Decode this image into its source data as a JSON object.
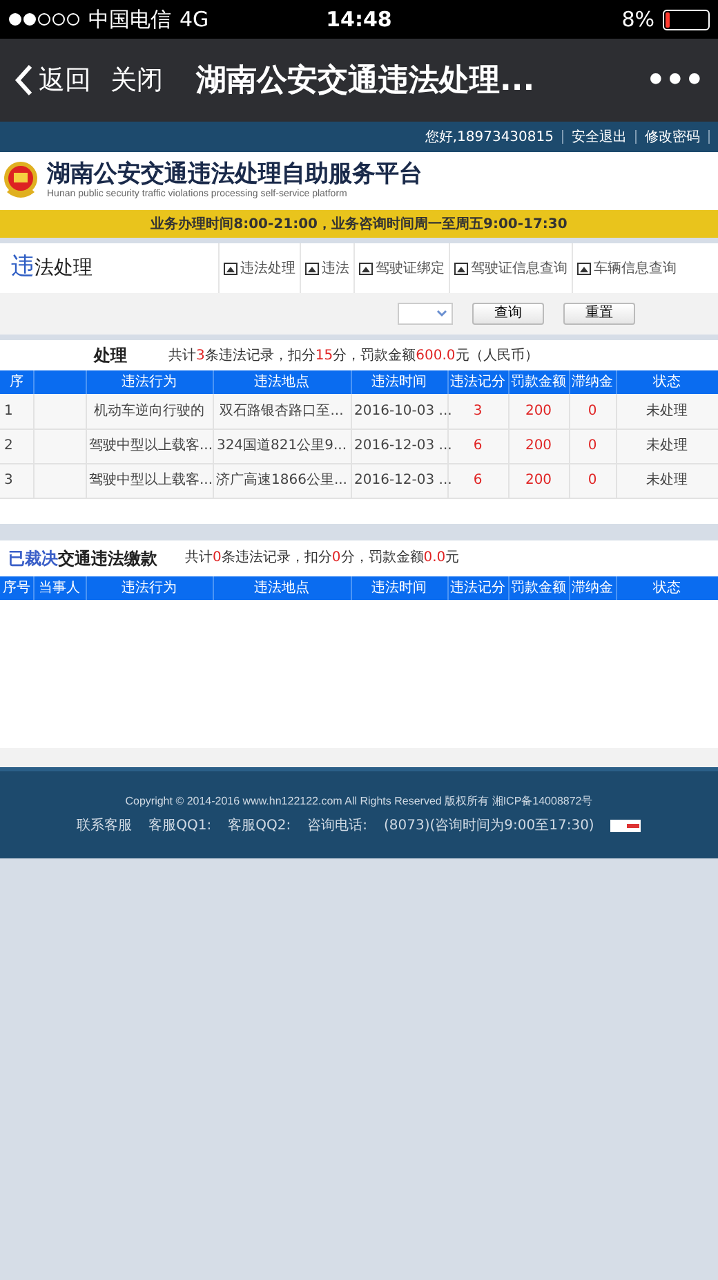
{
  "status_bar": {
    "carrier": "中国电信",
    "network": "4G",
    "time": "14:48",
    "battery": "8%"
  },
  "nav_bar": {
    "back": "返回",
    "close": "关闭",
    "title": "湖南公安交通违法处理...",
    "more": "•••"
  },
  "top_bar": {
    "links": [
      "您好,18973430815",
      "安全退出",
      "修改密码"
    ]
  },
  "site_header": {
    "title": "湖南公安交通违法处理自助服务平台",
    "subtitle": "Hunan public security traffic violations processing self-service platform"
  },
  "notice": "业务办理时间8:00-21:00，业务咨询时间周一至周五9:00-17:30",
  "section_tabs": {
    "title_parts": [
      {
        "text": "违",
        "highlight": true
      },
      {
        "text": "法处理",
        "highlight": false
      }
    ],
    "tabs": [
      {
        "label": "违法处理",
        "selected": false
      },
      {
        "label": "违法",
        "selected": false
      },
      {
        "label": "驾驶证绑定",
        "selected": false
      },
      {
        "label": "驾驶证信息查询",
        "selected": false
      },
      {
        "label": "车辆信息查询",
        "selected": false
      }
    ]
  },
  "search": {
    "buttons": [
      "查询",
      "重置"
    ]
  },
  "pending": {
    "title": "处理",
    "summary": [
      {
        "text": "共计",
        "highlight": false
      },
      {
        "text": "3",
        "highlight": true
      },
      {
        "text": "条违法记录，扣分",
        "highlight": false
      },
      {
        "text": "15",
        "highlight": true
      },
      {
        "text": "分，罚款金额",
        "highlight": false
      },
      {
        "text": "600.0",
        "highlight": true
      },
      {
        "text": "元（人民币）",
        "highlight": false
      }
    ],
    "columns": [
      "序",
      "",
      "违法行为",
      "违法地点",
      "违法时间",
      "违法记分",
      "罚款金额",
      "滞纳金",
      "状态"
    ],
    "rows": [
      [
        "1",
        "",
        "机动车逆向行驶的",
        "双石路银杏路口至...",
        "2016-10-03 ...",
        "3",
        "200",
        "0",
        "未处理"
      ],
      [
        "2",
        "",
        "驾驶中型以上载客...",
        "324国道821公里9...",
        "2016-12-03 ...",
        "6",
        "200",
        "0",
        "未处理"
      ],
      [
        "3",
        "",
        "驾驶中型以上载客...",
        "济广高速1866公里...",
        "2016-12-03 ...",
        "6",
        "200",
        "0",
        "未处理"
      ]
    ]
  },
  "decided": {
    "title_parts": [
      {
        "text": "已裁决",
        "highlight": true
      },
      {
        "text": "交通违法缴款",
        "highlight": false
      }
    ],
    "summary": [
      {
        "text": "共计",
        "highlight": false
      },
      {
        "text": "0",
        "highlight": true
      },
      {
        "text": "条违法记录，扣分",
        "highlight": false
      },
      {
        "text": "0",
        "highlight": true
      },
      {
        "text": "分，罚款金额",
        "highlight": false
      },
      {
        "text": "0.0",
        "highlight": true
      },
      {
        "text": "元",
        "highlight": false
      }
    ],
    "columns": [
      "序号",
      "当事人",
      "违法行为",
      "违法地点",
      "违法时间",
      "违法记分",
      "罚款金额",
      "滞纳金",
      "状态"
    ]
  },
  "footer": {
    "copyright": "Copyright © 2014-2016 www.hn122122.com All Rights Reserved 版权所有 湘ICP备14008872号",
    "contacts": [
      "联系客服",
      "客服QQ1:",
      "客服QQ2:",
      "咨询电话:",
      "(8073)(咨询时间为9:00至17:30)"
    ]
  }
}
